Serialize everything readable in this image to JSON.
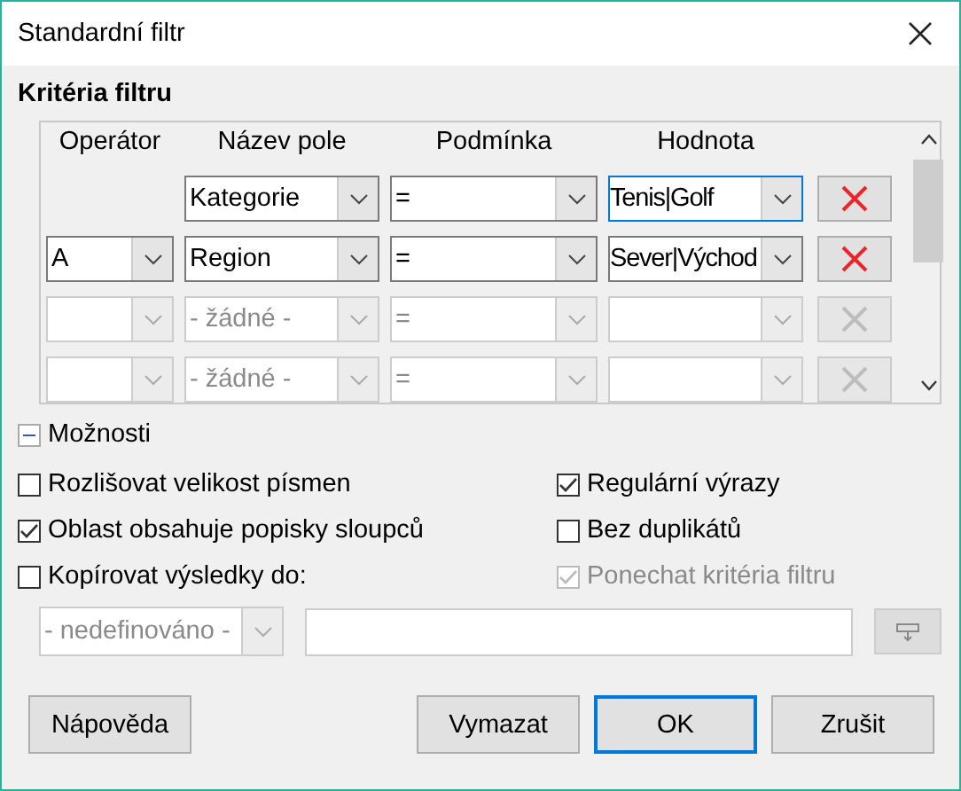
{
  "window": {
    "title": "Standardní filtr"
  },
  "criteria": {
    "title": "Kritéria filtru",
    "columns": [
      "Operátor",
      "Název pole",
      "Podmínka",
      "Hodnota"
    ],
    "rows": [
      {
        "kind": "first",
        "field": "Kategorie",
        "condition": "=",
        "value": "Tenis|Golf",
        "disabled": false,
        "focused": true
      },
      {
        "kind": "next",
        "operator": "A",
        "field": "Region",
        "condition": "=",
        "value": "Sever|Východ",
        "disabled": false,
        "focused": false
      },
      {
        "kind": "next",
        "field": "- žádné -",
        "condition": "=",
        "disabled": true,
        "focused": false
      },
      {
        "kind": "next",
        "field": "- žádné -",
        "condition": "=",
        "disabled": true,
        "focused": false
      }
    ]
  },
  "options": {
    "label": "Možnosti",
    "expanded": true,
    "checkboxes": [
      {
        "label": "Rozlišovat velikost písmen",
        "checked": false,
        "disabled": false
      },
      {
        "label": "Regulární výrazy",
        "checked": true,
        "disabled": false
      },
      {
        "label": "Oblast obsahuje popisky sloupců",
        "checked": true,
        "disabled": false
      },
      {
        "label": "Bez duplikátů",
        "checked": false,
        "disabled": false
      },
      {
        "label": "Kopírovat výsledky do:",
        "checked": false,
        "disabled": false
      },
      {
        "label": "Ponechat kritéria filtru",
        "checked": true,
        "disabled": true
      }
    ],
    "copy_to": {
      "area": "- nedefinováno -",
      "disabled": true
    }
  },
  "buttons": [
    {
      "label": "Nápověda",
      "kind": "help",
      "default": false
    },
    {
      "label": "Vymazat",
      "kind": "action",
      "default": false
    },
    {
      "label": "OK",
      "kind": "action",
      "default": true
    },
    {
      "label": "Zrušit",
      "kind": "action",
      "default": false
    }
  ]
}
